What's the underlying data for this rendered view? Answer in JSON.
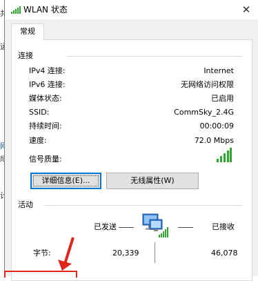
{
  "window": {
    "title": "WLAN 状态",
    "close_glyph": "✕"
  },
  "background_glyphs": [
    "共",
    "运",
    "网",
    "成",
    "计"
  ],
  "tabs": [
    {
      "label": "常规"
    }
  ],
  "connection": {
    "heading": "连接",
    "rows": [
      {
        "label": "IPv4 连接:",
        "value": "Internet"
      },
      {
        "label": "IPv6 连接:",
        "value": "无网络访问权限"
      },
      {
        "label": "媒体状态:",
        "value": "已启用"
      },
      {
        "label": "SSID:",
        "value": "CommSky_2.4G"
      },
      {
        "label": "持续时间:",
        "value": "00:00:09"
      },
      {
        "label": "速度:",
        "value": "72.0 Mbps"
      }
    ],
    "signal_label": "信号质量:",
    "signal_icon": "signal-bars-icon",
    "signal_bars": 5,
    "signal_color": "#2ea82e"
  },
  "buttons": {
    "details": "详细信息(E)...",
    "wireless_props": "无线属性(W)"
  },
  "activity": {
    "heading": "活动",
    "sent_label": "已发送",
    "received_label": "已接收",
    "bytes_label": "字节:",
    "bytes_sent": "20,339",
    "bytes_received": "46,078",
    "network_icon": "network-computers-icon"
  },
  "annotation": {
    "color": "#e0251a"
  }
}
